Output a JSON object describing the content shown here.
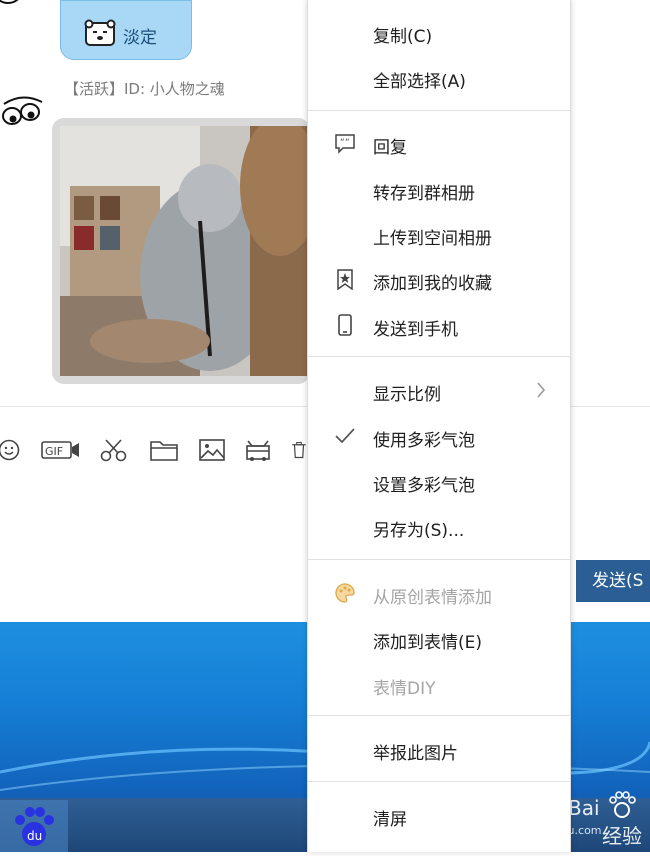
{
  "chat": {
    "bubble_tag_label": "淡定",
    "user_badge": "【活跃】ID: 小人物之魂"
  },
  "toolbar": {
    "gif_label": "GIF"
  },
  "send_button": {
    "label": "发送(S"
  },
  "context_menu": {
    "copy": "复制(C)",
    "select_all": "全部选择(A)",
    "reply": "回复",
    "save_to_group_album": "转存到群相册",
    "upload_to_zone_album": "上传到空间相册",
    "add_to_favorites": "添加到我的收藏",
    "send_to_phone": "发送到手机",
    "display_ratio": "显示比例",
    "use_colorful_bubble": "使用多彩气泡",
    "set_colorful_bubble": "设置多彩气泡",
    "save_as": "另存为(S)...",
    "add_from_original_stickers": "从原创表情添加",
    "add_to_stickers": "添加到表情(E)",
    "sticker_diy": "表情DIY",
    "report_image": "举报此图片",
    "clear_screen": "清屏"
  },
  "watermark": {
    "brand": "Bai",
    "brand_cn": "经验",
    "url": "jingyan.baidu.com"
  },
  "colors": {
    "bubble": "#a9d8f6",
    "send_button": "#2a5e94",
    "desktop": "#1e8fe0",
    "taskbar": "#1e4778",
    "disabled_text": "#a5a5a5"
  }
}
